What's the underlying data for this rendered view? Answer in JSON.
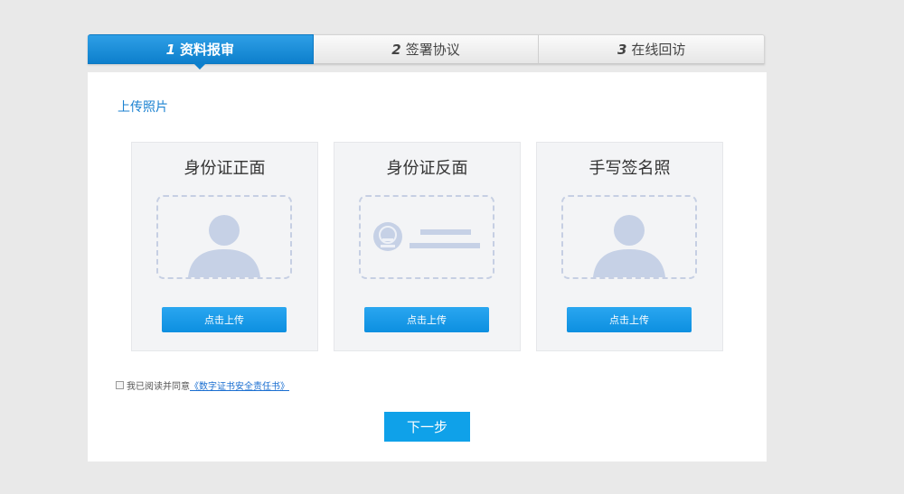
{
  "steps": [
    {
      "num": "1",
      "label": "资料报审",
      "active": true
    },
    {
      "num": "2",
      "label": "签署协议",
      "active": false
    },
    {
      "num": "3",
      "label": "在线回访",
      "active": false
    }
  ],
  "section_title": "上传照片",
  "cards": [
    {
      "title": "身份证正面",
      "icon": "person-silhouette-icon",
      "button": "点击上传"
    },
    {
      "title": "身份证反面",
      "icon": "national-emblem-icon",
      "button": "点击上传"
    },
    {
      "title": "手写签名照",
      "icon": "person-silhouette-icon",
      "button": "点击上传"
    }
  ],
  "agreement": {
    "text": "我已阅读并同意",
    "link": "《数字证书安全责任书》"
  },
  "next_button": "下一步",
  "colors": {
    "accent": "#0d7fcc",
    "button": "#0fa1e9",
    "placeholder": "#c6d1e6",
    "link": "#1b6fd1"
  }
}
